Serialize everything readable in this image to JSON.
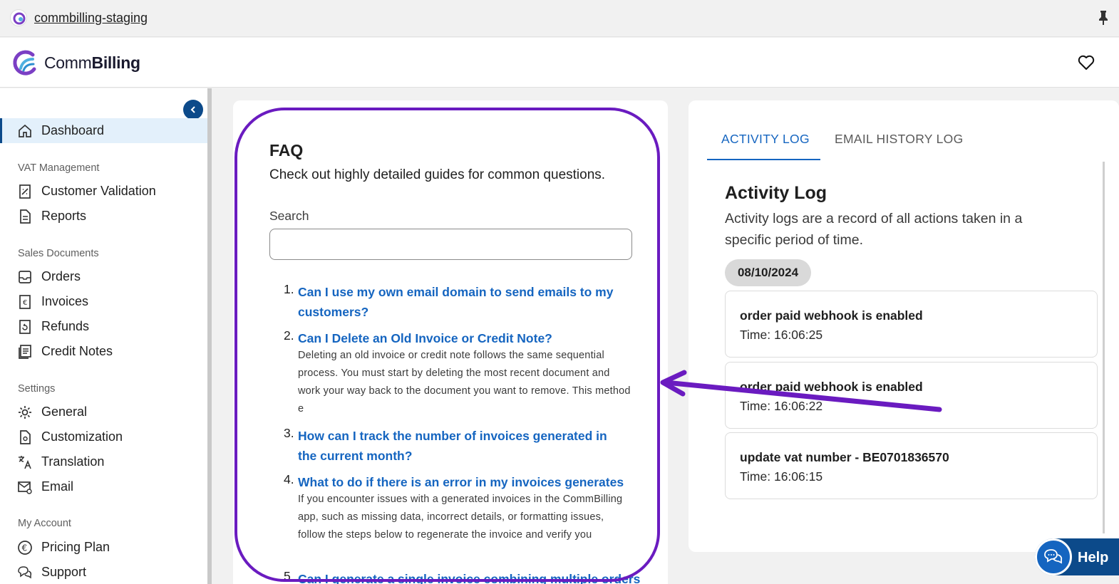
{
  "browser": {
    "site_name": "commbilling-staging"
  },
  "header": {
    "brand_light": "Comm",
    "brand_bold": "Billing"
  },
  "sidebar": {
    "dashboard": "Dashboard",
    "sections": {
      "vat": "VAT Management",
      "sales": "Sales Documents",
      "settings": "Settings",
      "account": "My Account"
    },
    "items": {
      "customer_validation": "Customer Validation",
      "reports": "Reports",
      "orders": "Orders",
      "invoices": "Invoices",
      "refunds": "Refunds",
      "credit_notes": "Credit Notes",
      "general": "General",
      "customization": "Customization",
      "translation": "Translation",
      "email": "Email",
      "pricing_plan": "Pricing Plan",
      "support": "Support"
    }
  },
  "faq": {
    "title": "FAQ",
    "subtitle": "Check out highly detailed guides for common questions.",
    "search_label": "Search",
    "search_value": "",
    "items": [
      {
        "num": "1.",
        "question": "Can I use my own email domain to send emails to my customers?",
        "answer": ""
      },
      {
        "num": "2.",
        "question": "Can I Delete an Old Invoice or Credit Note?",
        "answer": "Deleting an old invoice or credit note follows the same sequential process. You must start by deleting the most recent document and work your way back to the document you want to remove. This method e"
      },
      {
        "num": "3.",
        "question": "How can I track the number of invoices generated in the current month?",
        "answer": ""
      },
      {
        "num": "4.",
        "question": "What to do if there is an error in my invoices generates",
        "answer": "If you encounter issues with a generated invoices in the CommBilling app, such as missing data, incorrect details, or formatting issues, follow the steps below to regenerate the invoice and verify you"
      },
      {
        "num": "5.",
        "question": "Can I generate a single invoice combining multiple orders",
        "answer": ""
      }
    ]
  },
  "activity": {
    "tabs": [
      "ACTIVITY LOG",
      "EMAIL HISTORY LOG"
    ],
    "title": "Activity Log",
    "description": "Activity logs are a record of all actions taken in a specific period of time.",
    "date": "08/10/2024",
    "logs": [
      {
        "title": "order paid webhook is enabled",
        "time": "Time: 16:06:25"
      },
      {
        "title": "order paid webhook is enabled",
        "time": "Time: 16:06:22"
      },
      {
        "title": "update vat number - BE0701836570",
        "time": "Time: 16:06:15"
      }
    ]
  },
  "help": {
    "label": "Help"
  },
  "colors": {
    "accent": "#1565c0",
    "sidebar_active": "#e3f0fb",
    "annotation": "#6a1bc0",
    "help_bg": "#0c4a8a"
  }
}
